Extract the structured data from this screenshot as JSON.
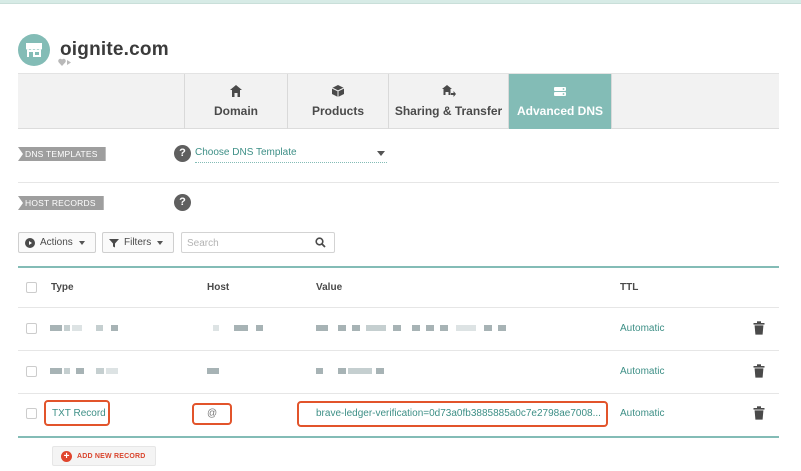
{
  "domain": {
    "name": "oignite.com"
  },
  "tabs": [
    {
      "label": "Domain",
      "icon": "home-icon",
      "active": false
    },
    {
      "label": "Products",
      "icon": "box-icon",
      "active": false
    },
    {
      "label": "Sharing & Transfer",
      "icon": "share-transfer-icon",
      "active": false
    },
    {
      "label": "Advanced DNS",
      "icon": "dns-icon",
      "active": true
    }
  ],
  "dns_templates": {
    "ribbon": "DNS TEMPLATES",
    "help": "?",
    "select_value": "Choose DNS Template"
  },
  "host_records": {
    "ribbon": "HOST RECORDS",
    "help": "?"
  },
  "toolbar": {
    "actions_label": "Actions",
    "filters_label": "Filters",
    "search_placeholder": "Search"
  },
  "table": {
    "columns": [
      "Type",
      "Host",
      "Value",
      "TTL"
    ],
    "rows": [
      {
        "type": "",
        "host": "",
        "value": "",
        "ttl": "Automatic",
        "redacted": true
      },
      {
        "type": "",
        "host": "",
        "value": "",
        "ttl": "Automatic",
        "redacted": true
      },
      {
        "type": "TXT Record",
        "host": "@",
        "value": "brave-ledger-verification=0d73a0fb3885885a0c7e2798ae7008...",
        "ttl": "Automatic",
        "redacted": false,
        "highlighted": true
      }
    ]
  },
  "add_record_label": "ADD NEW RECORD",
  "colors": {
    "accent": "#83bcb6",
    "link": "#3d8f86",
    "highlight": "#e2542b",
    "add": "#e0442c"
  }
}
